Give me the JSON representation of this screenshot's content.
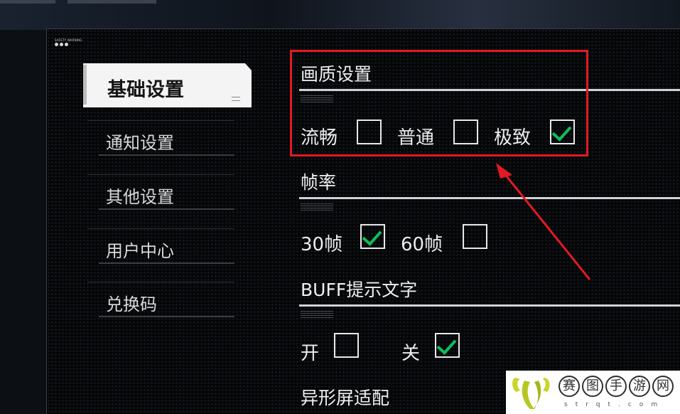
{
  "panel": {
    "warning_text": "SAFETY WARNING"
  },
  "sidebar": {
    "items": [
      {
        "label": "基础设置",
        "active": true
      },
      {
        "label": "通知设置",
        "active": false
      },
      {
        "label": "其他设置",
        "active": false
      },
      {
        "label": "用户中心",
        "active": false
      },
      {
        "label": "兑换码",
        "active": false
      }
    ]
  },
  "settings": {
    "quality": {
      "title": "画质设置",
      "options": [
        {
          "label": "流畅",
          "checked": false
        },
        {
          "label": "普通",
          "checked": false
        },
        {
          "label": "极致",
          "checked": true
        }
      ]
    },
    "framerate": {
      "title": "帧率",
      "options": [
        {
          "label": "30帧",
          "checked": true
        },
        {
          "label": "60帧",
          "checked": false
        }
      ]
    },
    "buff_text": {
      "title": "BUFF提示文字",
      "options": [
        {
          "label": "开",
          "checked": false
        },
        {
          "label": "关",
          "checked": true
        }
      ]
    },
    "notch": {
      "title": "异形屏适配"
    }
  },
  "colors": {
    "check": "#0cc05a",
    "highlight": "#e21a22",
    "panel_bg": "#050608"
  },
  "watermark": {
    "chars": [
      "赛",
      "图",
      "手",
      "游",
      "网"
    ],
    "url": "strqt.com"
  }
}
